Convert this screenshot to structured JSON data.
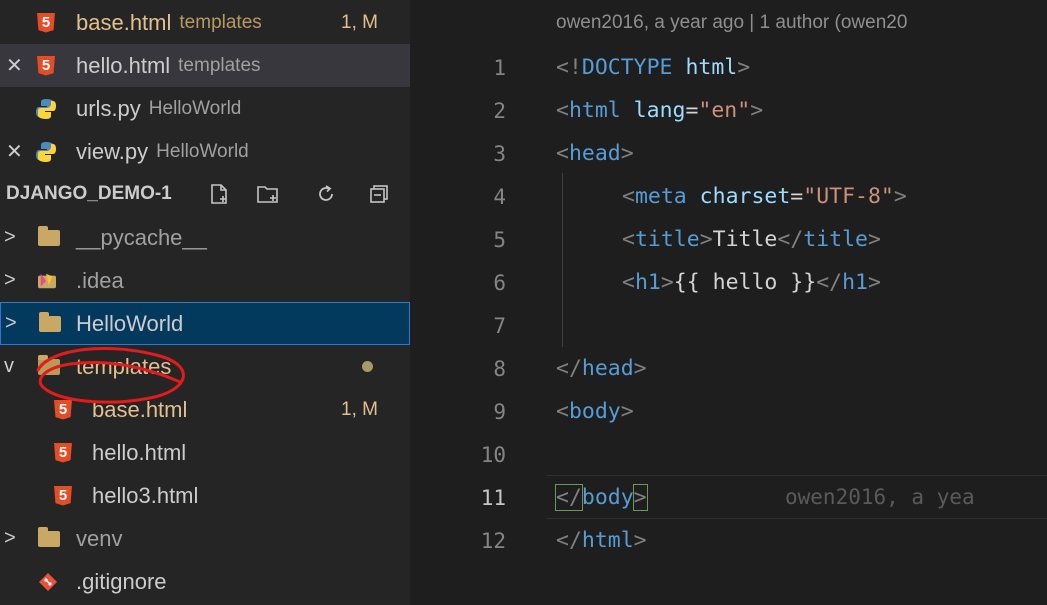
{
  "open_editors": [
    {
      "label": "base.html",
      "desc": "templates",
      "status": "1, M",
      "icon": "html5-icon",
      "modified": true,
      "closable": false
    },
    {
      "label": "hello.html",
      "desc": "templates",
      "status": "",
      "icon": "html5-icon",
      "modified": false,
      "closable": true
    },
    {
      "label": "urls.py",
      "desc": "HelloWorld",
      "status": "",
      "icon": "python-icon",
      "modified": false,
      "closable": false
    },
    {
      "label": "view.py",
      "desc": "HelloWorld",
      "status": "",
      "icon": "python-icon",
      "modified": false,
      "closable": true
    }
  ],
  "explorer": {
    "project_name": "DJANGO_DEMO-1",
    "toolbar_icons": [
      "new-file-icon",
      "new-folder-icon",
      "refresh-icon",
      "collapse-all-icon"
    ],
    "tree": [
      {
        "label": "__pycache__",
        "chevron": ">",
        "icon": "folder-icon"
      },
      {
        "label": ".idea",
        "chevron": ">",
        "icon": "idea-folder-icon"
      },
      {
        "label": "HelloWorld",
        "chevron": ">",
        "icon": "folder-icon",
        "focused": true
      },
      {
        "label": "templates",
        "chevron": "v",
        "icon": "folder-open-icon",
        "modified": true
      },
      {
        "label": "base.html",
        "icon": "html5-icon",
        "status": "1, M",
        "modified": true
      },
      {
        "label": "hello.html",
        "icon": "html5-icon"
      },
      {
        "label": "hello3.html",
        "icon": "html5-icon"
      },
      {
        "label": "venv",
        "chevron": ">",
        "icon": "folder-icon"
      },
      {
        "label": ".gitignore",
        "icon": "git-icon"
      }
    ]
  },
  "editor": {
    "blame_header": "owen2016, a year ago | 1 author (owen20",
    "line_numbers": [
      "1",
      "2",
      "3",
      "4",
      "5",
      "6",
      "7",
      "8",
      "9",
      "10",
      "11",
      "12"
    ],
    "active_line": "11",
    "inline_blame": "owen2016, a yea",
    "colors": {
      "tag": "#569cd6",
      "attr": "#9cdcfe",
      "string": "#ce9178",
      "text": "#d4d4d4"
    },
    "lines": {
      "l1": {
        "open": "<!",
        "tag": "DOCTYPE",
        "rest": " html",
        "close": ">"
      },
      "l2": {
        "open": "<",
        "tag": "html",
        "attr": " lang",
        "eq": "=",
        "str": "\"en\"",
        "close": ">"
      },
      "l3": {
        "open": "<",
        "tag": "head",
        "close": ">"
      },
      "l4": {
        "open": "<",
        "tag": "meta",
        "attr": " charset",
        "eq": "=",
        "str": "\"UTF-8\"",
        "close": ">"
      },
      "l5": {
        "open": "<",
        "tag": "title",
        "close": ">",
        "text": "Title",
        "open2": "</",
        "tag2": "title",
        "close2": ">"
      },
      "l6": {
        "open": "<",
        "tag": "h1",
        "close": ">",
        "text": "{{ hello }}",
        "open2": "</",
        "tag2": "h1",
        "close2": ">"
      },
      "l8": {
        "open": "</",
        "tag": "head",
        "close": ">"
      },
      "l9": {
        "open": "<",
        "tag": "body",
        "close": ">"
      },
      "l11": {
        "open": "</",
        "tag": "body",
        "close": ">"
      },
      "l12": {
        "open": "</",
        "tag": "html",
        "close": ">"
      }
    }
  }
}
